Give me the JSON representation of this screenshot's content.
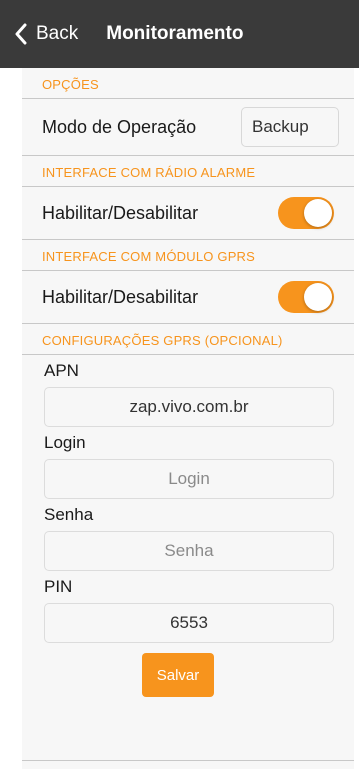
{
  "navbar": {
    "back_label": "Back",
    "title": "Monitoramento"
  },
  "sections": {
    "opcoes": {
      "header": "OPÇÕES",
      "mode_label": "Modo de Operação",
      "mode_value": "Backup"
    },
    "radio": {
      "header": "INTERFACE COM RÁDIO ALARME",
      "toggle_label": "Habilitar/Desabilitar",
      "toggle_on": true
    },
    "gprs": {
      "header": "INTERFACE COM MÓDULO GPRS",
      "toggle_label": "Habilitar/Desabilitar",
      "toggle_on": true
    },
    "gprs_config": {
      "header": "CONFIGURAÇÕES GPRS (OPCIONAL)",
      "apn_label": "APN",
      "apn_value": "zap.vivo.com.br",
      "login_label": "Login",
      "login_placeholder": "Login",
      "senha_label": "Senha",
      "senha_placeholder": "Senha",
      "pin_label": "PIN",
      "pin_value": "6553",
      "save_label": "Salvar"
    }
  },
  "colors": {
    "accent": "#f7941d",
    "navbar": "#3a3a3a",
    "background": "#f7f7f7"
  }
}
